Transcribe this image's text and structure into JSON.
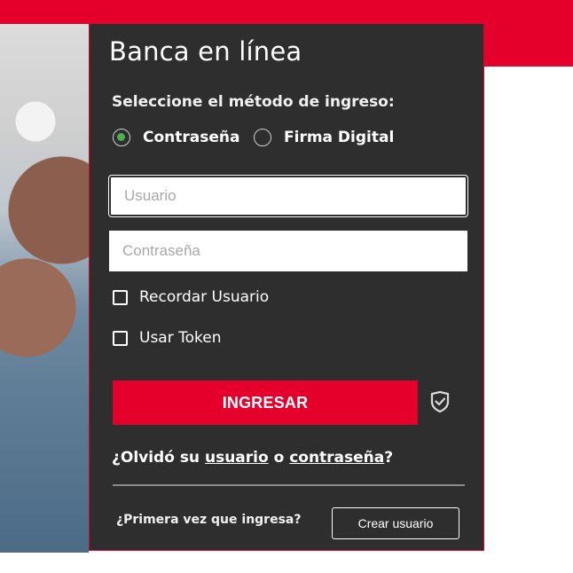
{
  "colors": {
    "brand_red": "#e4002b",
    "panel_bg": "#2e2e2e",
    "radio_selected": "#4caf50"
  },
  "login": {
    "title": "Banca en línea",
    "method_label": "Seleccione el método de ingreso:",
    "methods": [
      {
        "label": "Contraseña",
        "selected": true
      },
      {
        "label": "Firma Digital",
        "selected": false
      }
    ],
    "username_placeholder": "Usuario",
    "password_placeholder": "Contraseña",
    "remember_label": "Recordar Usuario",
    "token_label": "Usar Token",
    "submit_label": "INGRESAR",
    "security_icon": "shield-check-icon",
    "forgot": {
      "prefix": "¿Olvidó su ",
      "user_link": "usuario",
      "middle": " o ",
      "password_link": "contraseña",
      "suffix": "?"
    },
    "first_time": "¿Primera vez que ingresa?",
    "create_user_label": "Crear usuario"
  }
}
